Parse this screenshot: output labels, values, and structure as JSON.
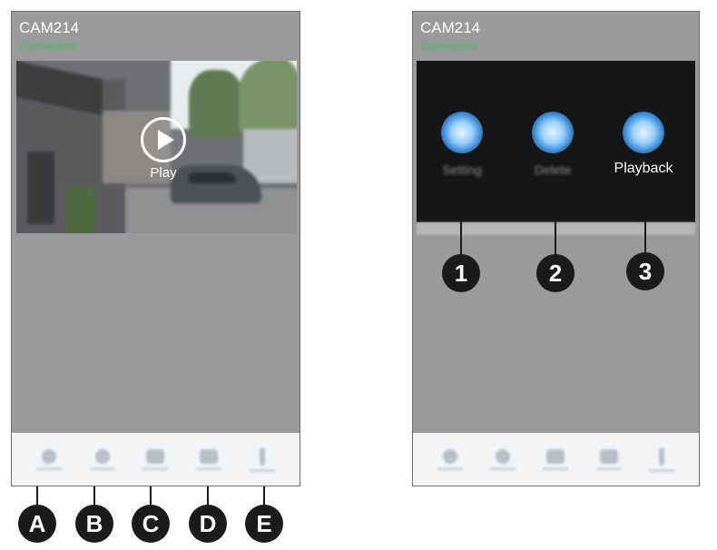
{
  "left_screen": {
    "camera_name": "CAM214",
    "status": "Connected",
    "play_label": "Play",
    "toolbar": [
      {
        "id": "A",
        "icon": "record-icon"
      },
      {
        "id": "B",
        "icon": "snapshot-icon"
      },
      {
        "id": "C",
        "icon": "talk-icon"
      },
      {
        "id": "D",
        "icon": "screen-icon"
      },
      {
        "id": "E",
        "icon": "more-icon"
      }
    ]
  },
  "right_screen": {
    "camera_name": "CAM214",
    "status": "Connected",
    "menu": {
      "settings": "Setting",
      "delete": "Delete",
      "playback": "Playback"
    }
  },
  "callouts": {
    "left": [
      "A",
      "B",
      "C",
      "D",
      "E"
    ],
    "right": [
      "1",
      "2",
      "3"
    ]
  },
  "colors": {
    "screen_bg": "#9a9a9c",
    "status_green": "#2fbf4a",
    "menu_bg": "#151617",
    "toolbar_bg": "#f3f4f6",
    "badge": "#1b1b1b"
  }
}
